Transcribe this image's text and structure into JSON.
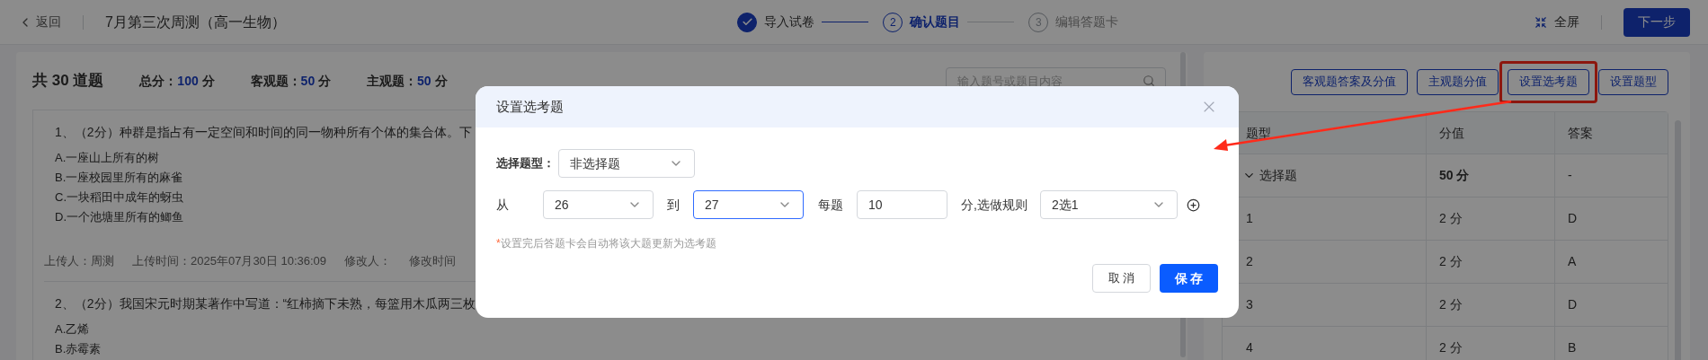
{
  "top_bar": {
    "back_label": "返回",
    "title": "7月第三次周测（高一生物）",
    "steps": [
      {
        "label": "导入试卷",
        "completed": true,
        "selected": false
      },
      {
        "number": "2",
        "label": "确认题目",
        "completed": false,
        "selected": true
      },
      {
        "number": "3",
        "label": "编辑答题卡",
        "completed": false,
        "selected": false
      }
    ],
    "fullscreen_label": "全屏",
    "next_button": "下一步"
  },
  "questions_panel": {
    "count_text": "共 30 道题",
    "stats": [
      {
        "label": "总分：",
        "value": "100",
        "unit": "分"
      },
      {
        "label": "客观题：",
        "value": "50",
        "unit": "分"
      },
      {
        "label": "主观题：",
        "value": "50",
        "unit": "分"
      }
    ],
    "search": {
      "placeholder": "输入题号或题目内容"
    },
    "questions": [
      {
        "stem": "1、（2分）种群是指占有一定空间和时间的同一物种所有个体的集合体。下",
        "options": [
          "A.一座山上所有的树",
          "B.一座校园里所有的麻雀",
          "C.一块稻田中成年的蚜虫",
          "D.一个池塘里所有的鲫鱼"
        ],
        "meta": [
          "上传人：周测",
          "上传时间：2025年07月30日 10:36:09",
          "修改人：",
          "修改时间"
        ]
      },
      {
        "stem": "2、（2分）我国宋元时期某著作中写道：“红柿摘下未熟，每篮用木瓜两三枚",
        "options": [
          "A.乙烯",
          "B.赤霉素"
        ]
      }
    ]
  },
  "score_panel": {
    "buttons": [
      {
        "label": "客观题答案及分值",
        "annotated": false
      },
      {
        "label": "主观题分值",
        "annotated": false
      },
      {
        "label": "设置选考题",
        "annotated": true
      },
      {
        "label": "设置题型",
        "annotated": false
      }
    ],
    "columns": [
      "题型",
      "分值",
      "答案"
    ],
    "rows": [
      {
        "kind": "group",
        "type": "选择题",
        "score": "50 分",
        "answer": "-",
        "expanded": true
      },
      {
        "kind": "item",
        "type": "1",
        "score": "2 分",
        "answer": "D"
      },
      {
        "kind": "item",
        "type": "2",
        "score": "2 分",
        "answer": "A"
      },
      {
        "kind": "item",
        "type": "3",
        "score": "2 分",
        "answer": "D"
      },
      {
        "kind": "item",
        "type": "4",
        "score": "2 分",
        "answer": "B"
      }
    ]
  },
  "dialog": {
    "title": "设置选考题",
    "type_label": "选择题型：",
    "type_value": "非选择题",
    "from_label": "从",
    "from_value": "26",
    "from_focused": false,
    "to_label": "到",
    "to_value": "27",
    "to_focused": true,
    "each_label": "每题",
    "each_value": "10",
    "rule_label": "分,选做规则",
    "rule_value": "2选1",
    "note_mark": "*",
    "note": "设置完后答题卡会自动将该大题更新为选考题",
    "cancel": "取 消",
    "save": "保 存"
  }
}
